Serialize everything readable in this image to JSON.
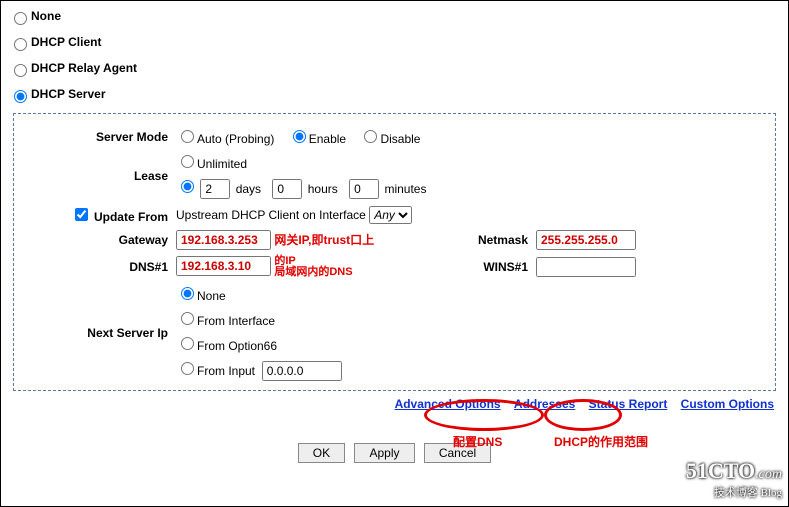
{
  "modes": {
    "none": "None",
    "dhcp_client": "DHCP Client",
    "dhcp_relay": "DHCP Relay Agent",
    "dhcp_server": "DHCP Server",
    "selected": "dhcp_server"
  },
  "server_mode": {
    "label": "Server Mode",
    "auto": "Auto (Probing)",
    "enable": "Enable",
    "disable": "Disable"
  },
  "lease": {
    "label": "Lease",
    "unlimited": "Unlimited",
    "days_val": "2",
    "days_unit": "days",
    "hours_val": "0",
    "hours_unit": "hours",
    "minutes_val": "0",
    "minutes_unit": "minutes"
  },
  "update_from": {
    "label": "Update From",
    "text": "Upstream DHCP Client on Interface",
    "iface": "Any"
  },
  "gateway": {
    "label": "Gateway",
    "value": "192.168.3.253",
    "annot1": "网关IP,即trust口上",
    "annot2": "的IP"
  },
  "dns": {
    "label": "DNS#1",
    "value": "192.168.3.10",
    "annot": "局域网内的DNS"
  },
  "netmask": {
    "label": "Netmask",
    "value": "255.255.255.0"
  },
  "wins": {
    "label": "WINS#1",
    "value": ""
  },
  "next_server": {
    "label": "Next Server Ip",
    "none": "None",
    "from_interface": "From Interface",
    "from_option66": "From Option66",
    "from_input": "From Input",
    "input_val": "0.0.0.0"
  },
  "links": {
    "advanced": "Advanced Options",
    "addresses": "Addresses",
    "status": "Status Report",
    "custom": "Custom Options",
    "annot_advanced": "配置DNS",
    "annot_addresses": "DHCP的作用范围"
  },
  "buttons": {
    "ok": "OK",
    "apply": "Apply",
    "cancel": "Cancel"
  },
  "watermark": {
    "site": "51CTO.com",
    "sub1": "技术博客",
    "sub2": "Blog"
  }
}
